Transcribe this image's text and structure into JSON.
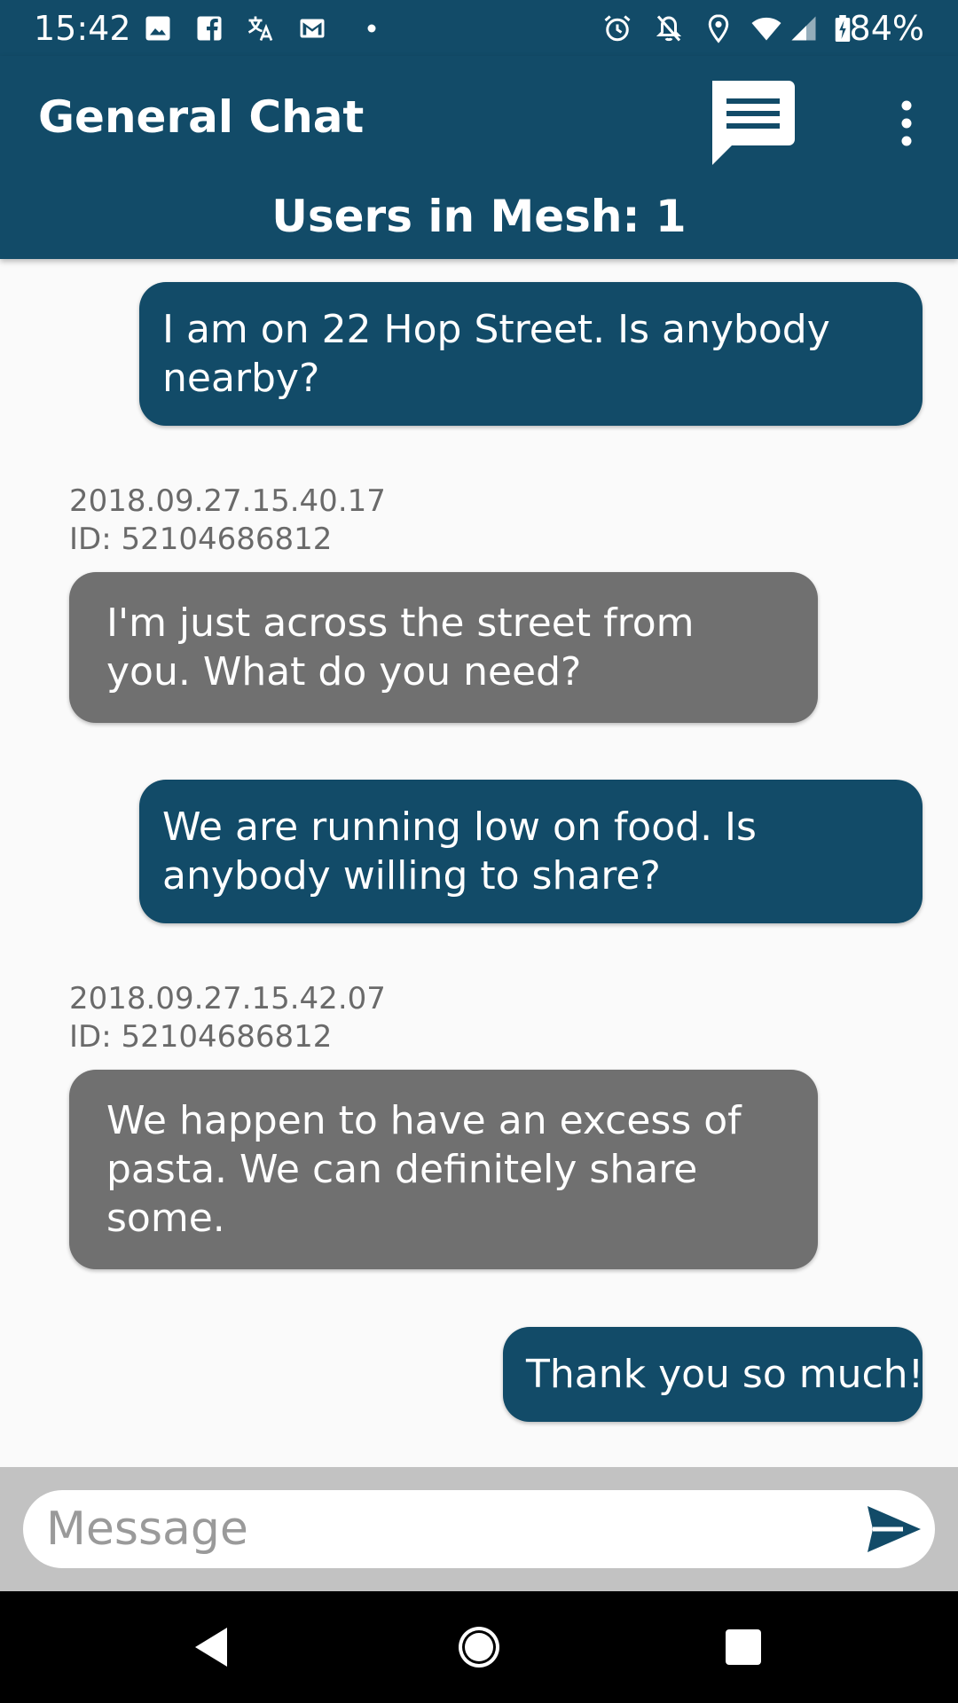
{
  "status_bar": {
    "time": "15:42",
    "battery": "84%",
    "left_icons": [
      "image-icon",
      "facebook-icon",
      "translate-icon",
      "gmail-icon",
      "dot-icon"
    ],
    "right_icons": [
      "alarm-icon",
      "notifications-off-icon",
      "location-icon",
      "wifi-icon",
      "cell-signal-icon",
      "battery-charging-icon"
    ]
  },
  "app_bar": {
    "title": "General Chat",
    "users_in_mesh": "Users in Mesh: 1",
    "actions": [
      "chat-icon",
      "overflow-menu-icon"
    ]
  },
  "messages": [
    {
      "direction": "outgoing",
      "text": "I am on 22 Hop Street. Is anybody nearby?"
    },
    {
      "direction": "incoming",
      "timestamp": "2018.09.27.15.40.17",
      "sender_id": "ID: 52104686812",
      "text": "I'm just across the street from you. What do you need?"
    },
    {
      "direction": "outgoing",
      "text": "We are running low on food. Is anybody willing to share?"
    },
    {
      "direction": "incoming",
      "timestamp": "2018.09.27.15.42.07",
      "sender_id": "ID: 52104686812",
      "text": "We happen to have an excess of pasta. We can definitely share some."
    },
    {
      "direction": "outgoing",
      "text": "Thank you so much!"
    }
  ],
  "composer": {
    "placeholder": "Message",
    "value": "",
    "send_icon": "send-icon"
  },
  "nav_bar": {
    "buttons": [
      "back-icon",
      "home-icon",
      "recents-icon"
    ]
  },
  "colors": {
    "primary": "#124b68",
    "incoming_bubble": "#707070",
    "chat_background": "#fafafa",
    "composer_background": "#c2c2c2",
    "meta_text": "#6a6a6a"
  }
}
